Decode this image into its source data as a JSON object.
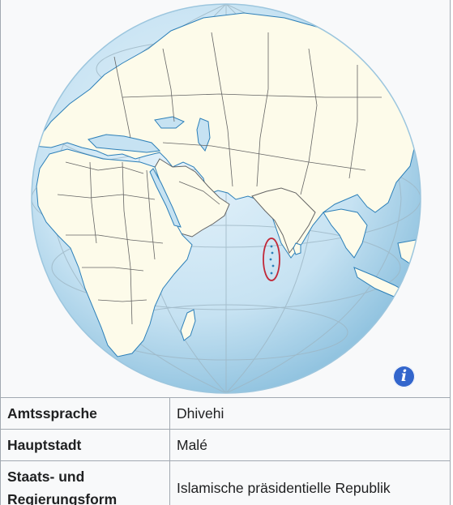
{
  "map": {
    "alt_icon": "info-icon",
    "info_glyph": "i",
    "colors": {
      "ocean": "#c6e2f2",
      "land": "#fdfbea",
      "border": "#646464",
      "coast": "#2c7fb8",
      "highlight": "#c12838"
    }
  },
  "facts": [
    {
      "label": "Amtssprache",
      "value": "Dhivehi"
    },
    {
      "label": "Hauptstadt",
      "value": "Malé"
    },
    {
      "label": "Staats- und Regierungsform",
      "value": "Islamische präsidentielle Republik"
    }
  ]
}
